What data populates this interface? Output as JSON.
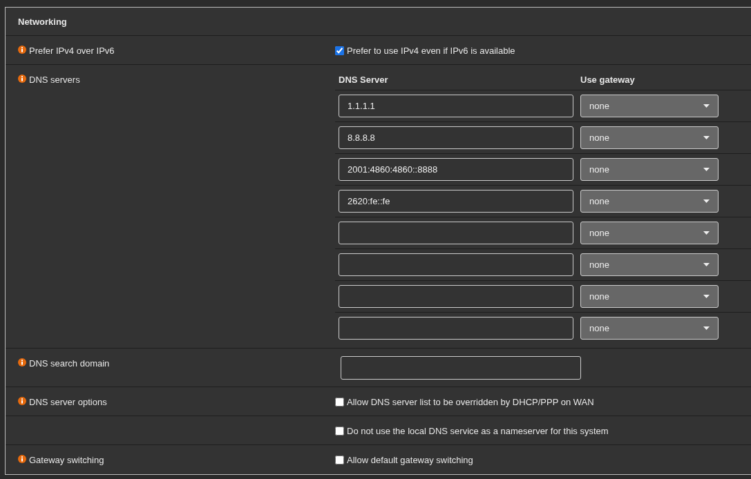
{
  "section": {
    "title": "Networking"
  },
  "rows": [
    {
      "kind": "checkbox",
      "label": "Prefer IPv4 over IPv6",
      "options": [
        {
          "text": "Prefer to use IPv4 even if IPv6 is available",
          "checked": true
        }
      ]
    },
    {
      "kind": "dns_table",
      "label": "DNS servers",
      "columns": [
        "DNS Server",
        "Use gateway"
      ],
      "servers": [
        {
          "value": "1.1.1.1",
          "gateway": "none"
        },
        {
          "value": "8.8.8.8",
          "gateway": "none"
        },
        {
          "value": "2001:4860:4860::8888",
          "gateway": "none"
        },
        {
          "value": "2620:fe::fe",
          "gateway": "none"
        },
        {
          "gateway": "none"
        },
        {
          "gateway": "none"
        },
        {
          "gateway": "none"
        },
        {
          "gateway": "none"
        }
      ]
    },
    {
      "kind": "text_input",
      "label": "DNS search domain"
    },
    {
      "kind": "checkbox",
      "label": "DNS server options",
      "options": [
        {
          "text": "Allow DNS server list to be overridden by DHCP/PPP on WAN",
          "checked": false
        }
      ]
    },
    {
      "kind": "checkbox",
      "options": [
        {
          "text": "Do not use the local DNS service as a nameserver for this system",
          "checked": false
        }
      ]
    },
    {
      "kind": "checkbox",
      "label": "Gateway switching",
      "options": [
        {
          "text": "Allow default gateway switching",
          "checked": false
        }
      ]
    }
  ]
}
